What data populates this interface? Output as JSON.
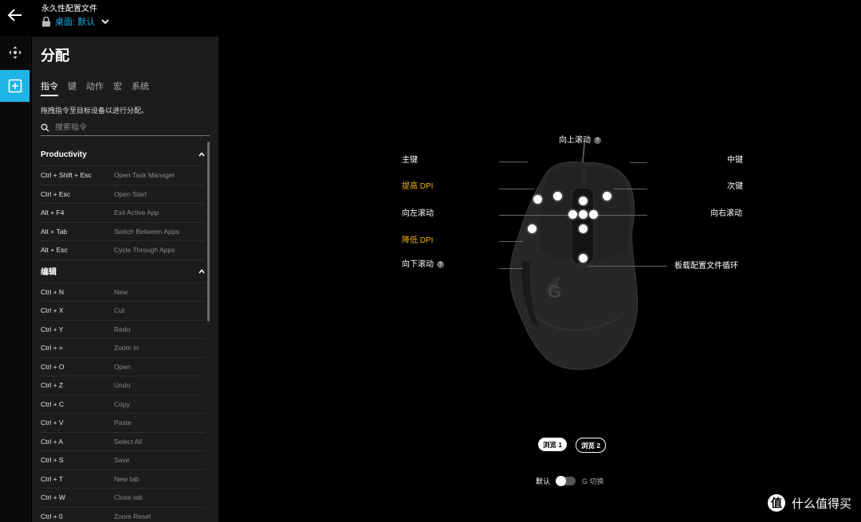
{
  "header": {
    "caption": "永久性配置文件",
    "profile_name": "桌面: 默认"
  },
  "panel": {
    "title": "分配",
    "tabs": [
      "指令",
      "键",
      "动作",
      "宏",
      "系统"
    ],
    "hint": "拖拽指令至目标设备以进行分配。",
    "search_placeholder": "搜索指令",
    "categories": [
      {
        "name": "Productivity",
        "rows": [
          {
            "key": "Ctrl + Shift + Esc",
            "action": "Open Task Manager"
          },
          {
            "key": "Ctrl + Esc",
            "action": "Open Start"
          },
          {
            "key": "Alt + F4",
            "action": "Exit Active App"
          },
          {
            "key": "Alt + Tab",
            "action": "Switch Between Apps"
          },
          {
            "key": "Alt + Esc",
            "action": "Cycle Through Apps"
          }
        ]
      },
      {
        "name": "编辑",
        "rows": [
          {
            "key": "Ctrl + N",
            "action": "New"
          },
          {
            "key": "Ctrl + X",
            "action": "Cut"
          },
          {
            "key": "Ctrl + Y",
            "action": "Redo"
          },
          {
            "key": "Ctrl + =",
            "action": "Zoom In"
          },
          {
            "key": "Ctrl + O",
            "action": "Open"
          },
          {
            "key": "Ctrl + Z",
            "action": "Undo"
          },
          {
            "key": "Ctrl + C",
            "action": "Copy"
          },
          {
            "key": "Ctrl + V",
            "action": "Paste"
          },
          {
            "key": "Ctrl + A",
            "action": "Select All"
          },
          {
            "key": "Ctrl + S",
            "action": "Save"
          },
          {
            "key": "Ctrl + T",
            "action": "New tab"
          },
          {
            "key": "Ctrl + W",
            "action": "Close tab"
          },
          {
            "key": "Ctrl + 0",
            "action": "Zoom Reset"
          }
        ]
      }
    ]
  },
  "mouse": {
    "labels": {
      "scroll_up": "向上滚动",
      "primary": "主键",
      "middle": "中键",
      "dpi_up": "提高 DPI",
      "secondary": "次键",
      "scroll_left": "向左滚动",
      "scroll_right": "向右滚动",
      "dpi_down": "降低 DPI",
      "scroll_down": "向下滚动",
      "profile_cycle": "板载配置文件循环"
    },
    "highlight_color": "#f2b200",
    "view_buttons": [
      "浏览 1",
      "浏览 2"
    ],
    "switch_left": "默认",
    "switch_right": "G 切换"
  },
  "watermark": "什么值得买"
}
